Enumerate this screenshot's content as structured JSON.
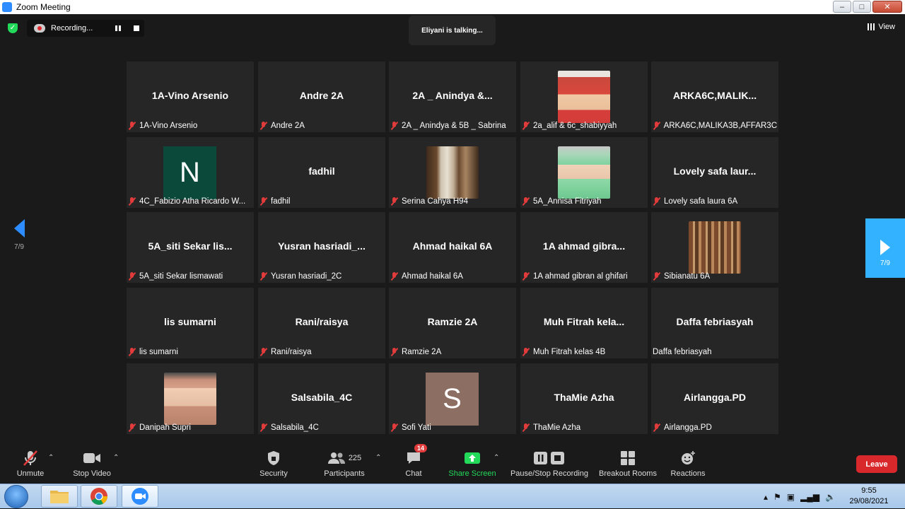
{
  "window": {
    "title": "Zoom Meeting"
  },
  "topbar": {
    "recording_label": "Recording...",
    "talking_text": "Eliyani is talking...",
    "view_label": "View"
  },
  "nav": {
    "left_page": "7/9",
    "right_page": "7/9"
  },
  "tiles": [
    {
      "big": "1A-Vino Arsenio",
      "cap": "1A-Vino Arsenio",
      "mic": true
    },
    {
      "big": "Andre  2A",
      "cap": "Andre  2A",
      "mic": true
    },
    {
      "big": "2A _ Anindya &...",
      "cap": "2A _ Anindya & 5B _ Sabrina",
      "mic": true
    },
    {
      "big": "",
      "cap": "2a_alif & 6c_shabiyyah",
      "mic": true,
      "photo": "hijab-red"
    },
    {
      "big": "ARKA6C,MALIK...",
      "cap": "ARKA6C,MALIKA3B,AFFAR3C",
      "mic": true
    },
    {
      "big": "",
      "cap": "4C_Fabizio Atha Ricardo W...",
      "mic": true,
      "initial": "N",
      "initial_bg": "#0b4a3a"
    },
    {
      "big": "fadhil",
      "cap": "fadhil",
      "mic": true
    },
    {
      "big": "",
      "cap": "Serina Cahya H94",
      "mic": true,
      "photo": "waterfall"
    },
    {
      "big": "",
      "cap": "5A_Annisa Fitriyah",
      "mic": true,
      "photo": "hijab-green"
    },
    {
      "big": "Lovely safa laur...",
      "cap": "Lovely safa laura 6A",
      "mic": true
    },
    {
      "big": "5A_siti Sekar lis...",
      "cap": "5A_siti Sekar lismawati",
      "mic": true
    },
    {
      "big": "Yusran  hasriadi_...",
      "cap": "Yusran hasriadi_2C",
      "mic": true
    },
    {
      "big": "Ahmad haikal 6A",
      "cap": "Ahmad haikal 6A",
      "mic": true
    },
    {
      "big": "1A ahmad gibra...",
      "cap": "1A ahmad gibran al ghifari",
      "mic": true
    },
    {
      "big": "",
      "cap": "Sibianatu 6A",
      "mic": true,
      "photo": "library"
    },
    {
      "big": "lis sumarni",
      "cap": "lis sumarni",
      "mic": true
    },
    {
      "big": "Rani/raisya",
      "cap": "Rani/raisya",
      "mic": true
    },
    {
      "big": "Ramzie 2A",
      "cap": "Ramzie 2A",
      "mic": true
    },
    {
      "big": "Muh Fitrah  kela...",
      "cap": "Muh Fitrah kelas 4B",
      "mic": true
    },
    {
      "big": "Daffa febriasyah",
      "cap": "Daffa febriasyah",
      "mic": false
    },
    {
      "big": "",
      "cap": "Danipah Supri",
      "mic": true,
      "photo": "hijab-pink"
    },
    {
      "big": "Salsabila_4C",
      "cap": "Salsabila_4C",
      "mic": true
    },
    {
      "big": "",
      "cap": "Sofi Yati",
      "mic": true,
      "initial": "S",
      "initial_bg": "#8d6e63"
    },
    {
      "big": "ThaMie Azha",
      "cap": "ThaMie Azha",
      "mic": true
    },
    {
      "big": "Airlangga.PD",
      "cap": "Airlangga.PD",
      "mic": true
    }
  ],
  "toolbar": {
    "unmute": "Unmute",
    "stop_video": "Stop Video",
    "security": "Security",
    "participants": "Participants",
    "participants_count": "225",
    "chat": "Chat",
    "chat_badge": "14",
    "share_screen": "Share Screen",
    "pause_stop_recording": "Pause/Stop Recording",
    "breakout_rooms": "Breakout Rooms",
    "reactions": "Reactions",
    "leave": "Leave"
  },
  "taskbar": {
    "time": "9:55",
    "date": "29/08/2021"
  },
  "colors": {
    "accent": "#2d8cff",
    "share_green": "#23d959",
    "leave_red": "#d9282b",
    "muted_red": "#e23b3b"
  }
}
